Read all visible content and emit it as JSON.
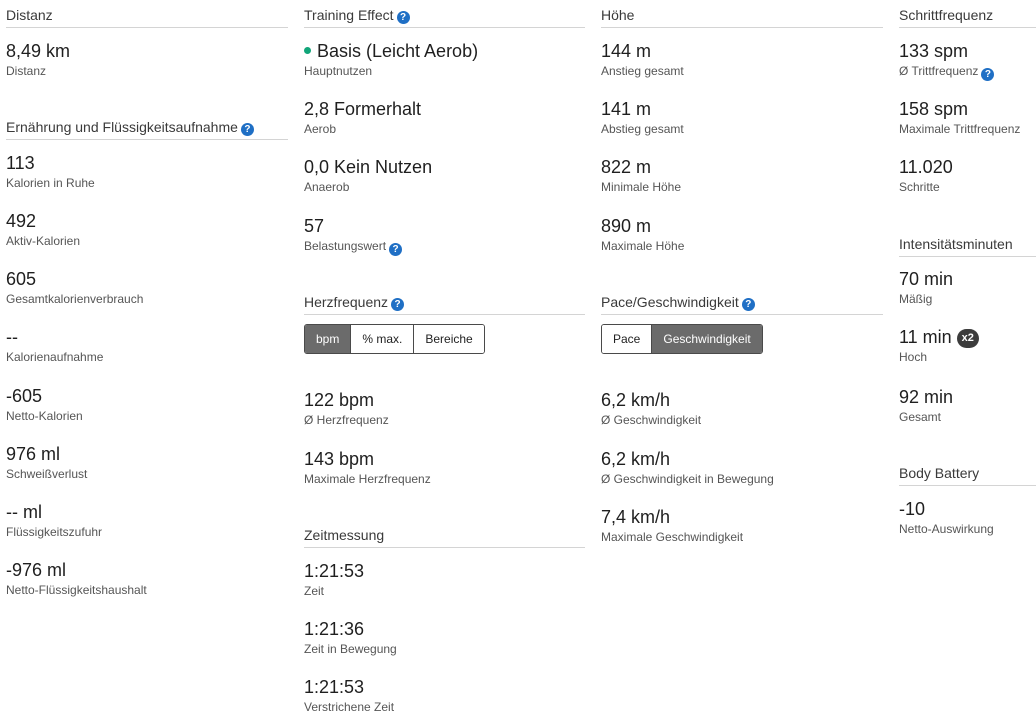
{
  "col1": {
    "distance": {
      "title": "Distanz",
      "stats": [
        {
          "value": "8,49 km",
          "label": "Distanz"
        }
      ]
    },
    "nutrition": {
      "title": "Ernährung und Flüssigkeitsaufnahme",
      "stats": [
        {
          "value": "113",
          "label": "Kalorien in Ruhe"
        },
        {
          "value": "492",
          "label": "Aktiv-Kalorien"
        },
        {
          "value": "605",
          "label": "Gesamtkalorienverbrauch"
        },
        {
          "value": "--",
          "label": "Kalorienaufnahme"
        },
        {
          "value": "-605",
          "label": "Netto-Kalorien"
        },
        {
          "value": "976 ml",
          "label": "Schweißverlust"
        },
        {
          "value": "-- ml",
          "label": "Flüssigkeitszufuhr"
        },
        {
          "value": "-976 ml",
          "label": "Netto-Flüssigkeitshaushalt"
        }
      ]
    }
  },
  "col2": {
    "training_effect": {
      "title": "Training Effect",
      "stats": [
        {
          "value": "Basis (Leicht Aerob)",
          "label": "Hauptnutzen"
        },
        {
          "value": "2,8 Formerhalt",
          "label": "Aerob"
        },
        {
          "value": "0,0 Kein Nutzen",
          "label": "Anaerob"
        },
        {
          "value": "57",
          "label": "Belastungswert"
        }
      ],
      "primary_dot_color": "#11a579"
    },
    "heart_rate": {
      "title": "Herzfrequenz",
      "tabs": [
        "bpm",
        "% max.",
        "Bereiche"
      ],
      "active_tab": "bpm",
      "stats": [
        {
          "value": "122 bpm",
          "label": "Ø Herzfrequenz"
        },
        {
          "value": "143 bpm",
          "label": "Maximale Herzfrequenz"
        }
      ]
    },
    "timing": {
      "title": "Zeitmessung",
      "stats": [
        {
          "value": "1:21:53",
          "label": "Zeit"
        },
        {
          "value": "1:21:36",
          "label": "Zeit in Bewegung"
        },
        {
          "value": "1:21:53",
          "label": "Verstrichene Zeit"
        }
      ]
    }
  },
  "col3": {
    "elevation": {
      "title": "Höhe",
      "stats": [
        {
          "value": "144 m",
          "label": "Anstieg gesamt"
        },
        {
          "value": "141 m",
          "label": "Abstieg gesamt"
        },
        {
          "value": "822 m",
          "label": "Minimale Höhe"
        },
        {
          "value": "890 m",
          "label": "Maximale Höhe"
        }
      ]
    },
    "pace": {
      "title": "Pace/Geschwindigkeit",
      "tabs": [
        "Pace",
        "Geschwindigkeit"
      ],
      "active_tab": "Geschwindigkeit",
      "stats": [
        {
          "value": "6,2 km/h",
          "label": "Ø Geschwindigkeit"
        },
        {
          "value": "6,2 km/h",
          "label": "Ø Geschwindigkeit in Bewegung"
        },
        {
          "value": "7,4 km/h",
          "label": "Maximale Geschwindigkeit"
        }
      ]
    }
  },
  "col4": {
    "cadence": {
      "title": "Schrittfrequenz",
      "stats": [
        {
          "value": "133 spm",
          "label": "Ø Trittfrequenz"
        },
        {
          "value": "158 spm",
          "label": "Maximale Trittfrequenz"
        },
        {
          "value": "11.020",
          "label": "Schritte"
        }
      ]
    },
    "intensity": {
      "title": "Intensitätsminuten",
      "stats": [
        {
          "value": "70 min",
          "label": "Mäßig"
        },
        {
          "value": "11 min",
          "label": "Hoch",
          "badge": "x2"
        },
        {
          "value": "92 min",
          "label": "Gesamt"
        }
      ]
    },
    "body_battery": {
      "title": "Body Battery",
      "stats": [
        {
          "value": "-10",
          "label": "Netto-Auswirkung"
        }
      ]
    }
  },
  "ui": {
    "help_glyph": "?",
    "help_color": "#1f6fc5",
    "active_tab_color": "#6b6b6b"
  }
}
